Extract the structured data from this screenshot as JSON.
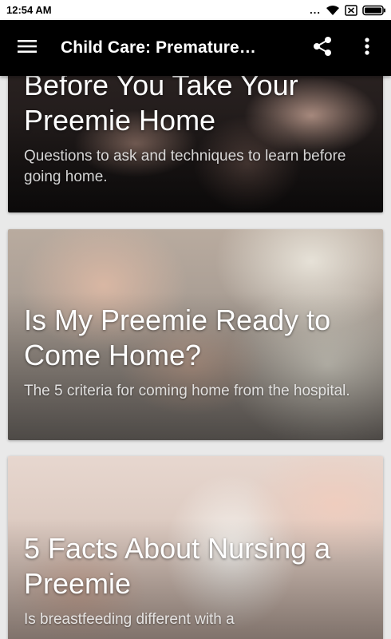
{
  "status_bar": {
    "time": "12:54 AM",
    "dots": "...",
    "icons": [
      "wifi-icon",
      "sim-disabled-icon",
      "battery-icon"
    ]
  },
  "app_bar": {
    "title": "Child Care: Premature…",
    "menu_icon": "menu-icon",
    "share_icon": "share-icon",
    "more_icon": "more-vert-icon"
  },
  "cards": [
    {
      "title": "Before You Take Your Preemie Home",
      "subtitle": "Questions to ask and techniques to learn before going home."
    },
    {
      "title": "Is My Preemie Ready to Come Home?",
      "subtitle": "The 5 criteria for coming home from the hospital."
    },
    {
      "title": "5 Facts About Nursing a Preemie",
      "subtitle": "Is breastfeeding different with a"
    }
  ],
  "colors": {
    "app_bar_bg": "#000000",
    "status_bar_bg": "#ffffff",
    "page_bg": "#e9e9e9",
    "card_text": "#ffffff"
  }
}
